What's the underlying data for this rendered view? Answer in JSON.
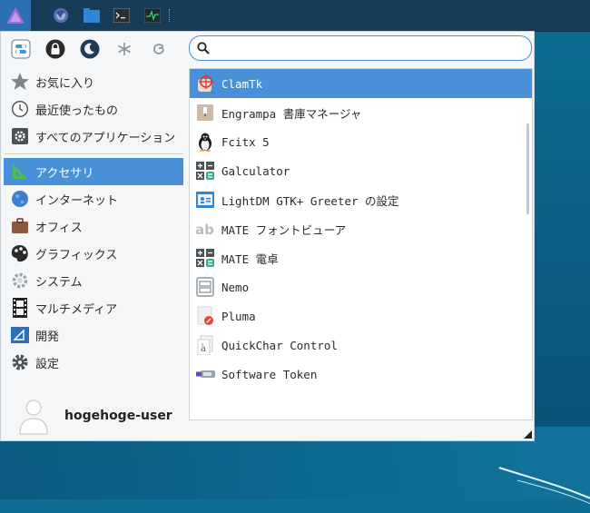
{
  "panel": {
    "launchers": [
      "whisker-menu-icon",
      "web-browser-icon",
      "file-manager-icon",
      "terminal-icon",
      "task-manager-icon"
    ]
  },
  "quick_actions": [
    "settings-toggle-icon",
    "lock-screen-icon",
    "suspend-icon",
    "switch-user-icon",
    "logout-icon"
  ],
  "search": {
    "placeholder": "",
    "value": ""
  },
  "categories": [
    {
      "label": "お気に入り",
      "icon": "star-icon"
    },
    {
      "label": "最近使ったもの",
      "icon": "clock-icon"
    },
    {
      "label": "すべてのアプリケーション",
      "icon": "gear-icon"
    },
    {
      "label": "アクセサリ",
      "icon": "ruler-icon",
      "active": true
    },
    {
      "label": "インターネット",
      "icon": "globe-icon"
    },
    {
      "label": "オフィス",
      "icon": "briefcase-icon"
    },
    {
      "label": "グラフィックス",
      "icon": "palette-icon"
    },
    {
      "label": "システム",
      "icon": "cog-icon"
    },
    {
      "label": "マルチメディア",
      "icon": "film-icon"
    },
    {
      "label": "開発",
      "icon": "blueprint-icon"
    },
    {
      "label": "設定",
      "icon": "settings-icon"
    }
  ],
  "apps": [
    {
      "label": "ClamTk",
      "icon": "clamtk-icon",
      "selected": true
    },
    {
      "label": "Engrampa 書庫マネージャ",
      "icon": "archive-icon"
    },
    {
      "label": "Fcitx 5",
      "icon": "penguin-icon"
    },
    {
      "label": "Galculator",
      "icon": "calculator-icon"
    },
    {
      "label": "LightDM GTK+ Greeter の設定",
      "icon": "greeter-icon"
    },
    {
      "label": "MATE フォントビューア",
      "icon": "font-icon"
    },
    {
      "label": "MATE 電卓",
      "icon": "calculator-icon"
    },
    {
      "label": "Nemo",
      "icon": "nemo-icon"
    },
    {
      "label": "Pluma",
      "icon": "text-editor-icon"
    },
    {
      "label": "QuickChar Control",
      "icon": "quickchar-icon"
    },
    {
      "label": "Software Token",
      "icon": "token-icon"
    }
  ],
  "user": {
    "name": "hogehoge-user"
  },
  "colors": {
    "accent": "#4a90d9",
    "panel": "#173c58",
    "menu_bg": "#f4f6f8"
  }
}
